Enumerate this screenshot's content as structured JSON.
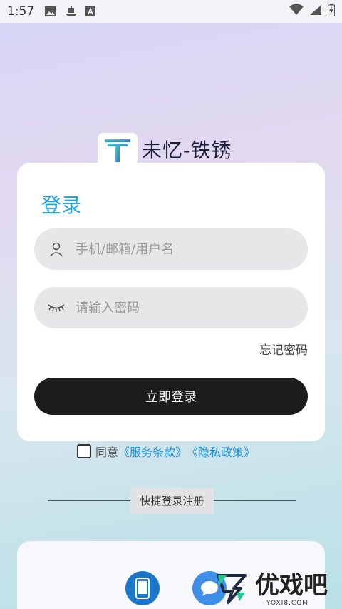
{
  "status_bar": {
    "time": "1:57",
    "icons": [
      "image-icon",
      "ship-icon",
      "a-box-icon"
    ],
    "right_icons": [
      "wifi-icon",
      "signal-icon",
      "battery-icon"
    ]
  },
  "brand": {
    "name": "未忆-铁锈"
  },
  "login": {
    "title": "登录",
    "username_placeholder": "手机/邮箱/用户名",
    "password_placeholder": "请输入密码",
    "forgot": "忘记密码",
    "submit": "立即登录"
  },
  "agreement": {
    "prefix": "同意",
    "terms": "《服务条款》",
    "privacy": "《隐私政策》"
  },
  "quick": {
    "label": "快捷登录注册"
  },
  "watermark": {
    "text": "优戏吧",
    "sub": "YOXI8.COM"
  },
  "colors": {
    "accent": "#1aa6e6",
    "link": "#1b8fd6",
    "button": "#1c1c1c"
  }
}
